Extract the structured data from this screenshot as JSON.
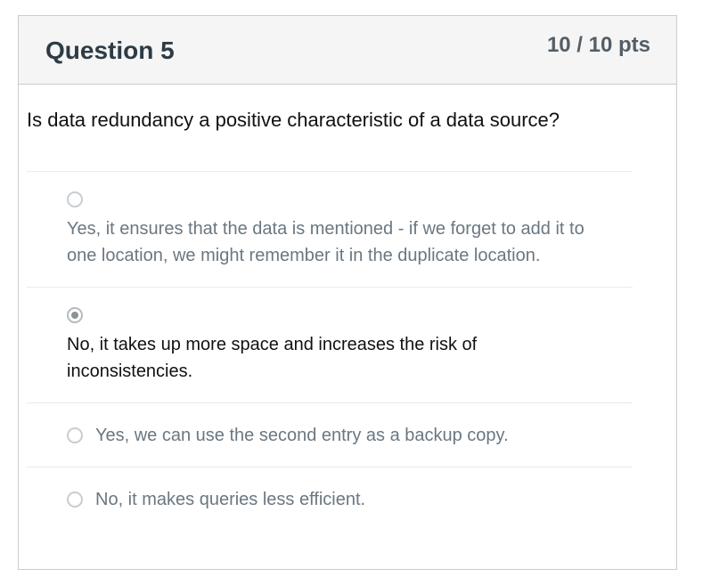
{
  "question": {
    "title": "Question 5",
    "points": "10 / 10 pts",
    "text": "Is data redundancy a positive characteristic of a data source?"
  },
  "answers": [
    {
      "text": "Yes, it ensures that the data is mentioned - if we forget to add it to one location, we might remember it in the duplicate location.",
      "selected": false
    },
    {
      "text": "No, it takes up more space and increases the risk of inconsistencies.",
      "selected": true
    },
    {
      "text": "Yes, we can use the second entry as a backup copy.",
      "selected": false
    },
    {
      "text": "No, it makes queries less efficient.",
      "selected": false
    }
  ]
}
